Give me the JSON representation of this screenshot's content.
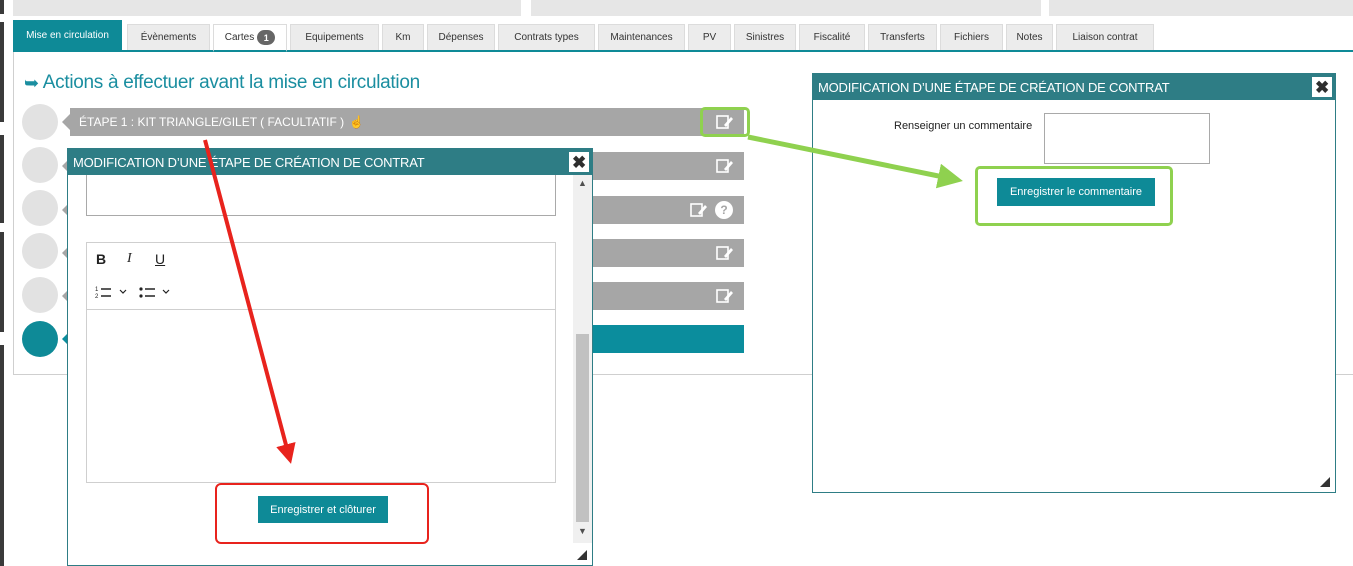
{
  "tabs": [
    {
      "label": "Mise en circulation",
      "state": "active"
    },
    {
      "label": "Évènements",
      "state": "normal"
    },
    {
      "label": "Cartes",
      "state": "selected",
      "badge": "1"
    },
    {
      "label": "Equipements",
      "state": "normal"
    },
    {
      "label": "Km",
      "state": "normal"
    },
    {
      "label": "Dépenses",
      "state": "normal"
    },
    {
      "label": "Contrats types",
      "state": "normal"
    },
    {
      "label": "Maintenances",
      "state": "normal"
    },
    {
      "label": "PV",
      "state": "normal"
    },
    {
      "label": "Sinistres",
      "state": "normal"
    },
    {
      "label": "Fiscalité",
      "state": "normal"
    },
    {
      "label": "Transferts",
      "state": "normal"
    },
    {
      "label": "Fichiers",
      "state": "normal"
    },
    {
      "label": "Notes",
      "state": "normal"
    },
    {
      "label": "Liaison contrat",
      "state": "normal"
    }
  ],
  "section": {
    "title": "Actions à effectuer avant la mise en circulation",
    "arrow_icon": "right-arrow-icon"
  },
  "steps": [
    {
      "label": "ÉTAPE 1 : KIT TRIANGLE/GILET ( FACULTATIF )",
      "icons": [
        "hand-pointer-icon",
        "edit-comment-icon"
      ]
    },
    {
      "label": "",
      "icons": [
        "edit-comment-icon"
      ]
    },
    {
      "label": "",
      "icons": [
        "edit-comment-icon",
        "help-icon"
      ]
    },
    {
      "label": "",
      "icons": [
        "edit-comment-icon"
      ]
    },
    {
      "label": "",
      "icons": [
        "edit-comment-icon"
      ]
    },
    {
      "label": "",
      "icons": [],
      "active": true
    }
  ],
  "dialog_left": {
    "title": "MODIFICATION D’UNE ÉTAPE DE CRÉATION DE CONTRAT",
    "close_label": "✖",
    "toolbar": {
      "bold": "B",
      "italic": "I",
      "underline": "U"
    },
    "save_close_label": "Enregistrer et clôturer"
  },
  "dialog_right": {
    "title": "MODIFICATION D’UNE ÉTAPE DE CRÉATION DE CONTRAT",
    "close_label": "✖",
    "comment_label": "Renseigner un commentaire",
    "comment_value": "",
    "save_comment_label": "Enregistrer le commentaire"
  },
  "colors": {
    "teal": "#0e8a97",
    "dialog_header": "#2e7d85",
    "step_gray": "#a6a6a6",
    "highlight_green": "#8fd14f",
    "highlight_red": "#e8231d"
  }
}
